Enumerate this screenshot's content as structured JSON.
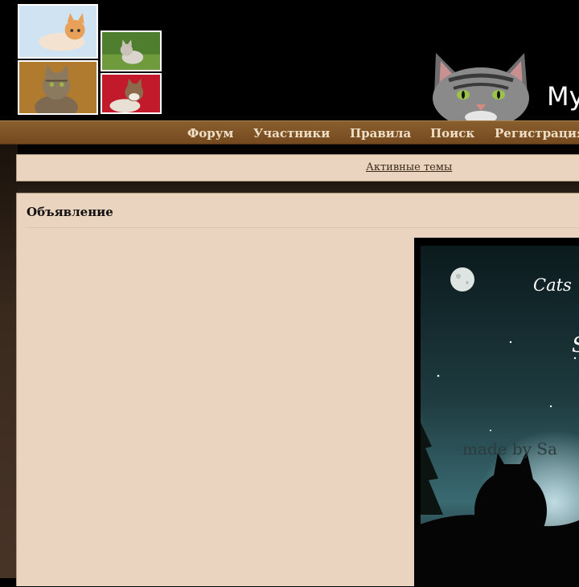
{
  "header": {
    "site_title": "My",
    "thumbnails": [
      {
        "name": "kitten-on-blue-thumbnail"
      },
      {
        "name": "tabby-cat-thumbnail"
      },
      {
        "name": "kitten-on-grass-thumbnail"
      },
      {
        "name": "kitten-on-red-thumbnail"
      }
    ]
  },
  "nav": {
    "items": [
      {
        "label": "Форум"
      },
      {
        "label": "Участники"
      },
      {
        "label": "Правила"
      },
      {
        "label": "Поиск"
      },
      {
        "label": "Регистрация"
      }
    ]
  },
  "active_topics": {
    "label": "Активные темы"
  },
  "announcement": {
    "title": "Объявление",
    "banner": {
      "text_top": "Cats",
      "text_mid": "S",
      "watermark": "made by Sa"
    }
  },
  "colors": {
    "page_bg": "#000000",
    "nav_bg": "#7f5427",
    "nav_text": "#efdfc6",
    "panel_bg": "#ead4bf"
  }
}
